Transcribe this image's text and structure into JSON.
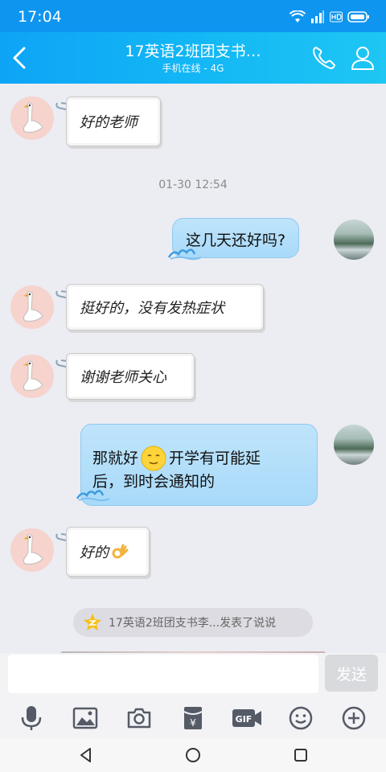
{
  "status_bar": {
    "time": "17:04"
  },
  "header": {
    "title": "17英语2班团支书…",
    "subtitle": "手机在线 - 4G"
  },
  "chat": {
    "timestamp": "01-30 12:54",
    "messages": [
      {
        "sender": "other",
        "text": "好的老师"
      },
      {
        "sender": "me",
        "text": "这几天还好吗?"
      },
      {
        "sender": "other",
        "text": "挺好的，没有发热症状"
      },
      {
        "sender": "other",
        "text": "谢谢老师关心"
      },
      {
        "sender": "me",
        "text_line1_before_emoji": "那就好",
        "text_line1_after_emoji": "开学有可能延",
        "text_line2": "后，到时会通知的",
        "emoji": "smile-emoji"
      },
      {
        "sender": "other",
        "text": "好的",
        "emoji": "ok-hand-emoji"
      }
    ],
    "notice": {
      "text": "17英语2班团支书李...发表了说说"
    }
  },
  "input": {
    "value": "",
    "placeholder": "",
    "send_label": "发送"
  },
  "toolbar": {
    "icons": [
      "microphone-icon",
      "image-icon",
      "camera-icon",
      "red-packet-icon",
      "gif-icon",
      "emoji-icon",
      "plus-icon"
    ],
    "red_packet_symbol": "¥",
    "gif_label": "GIF"
  },
  "colors": {
    "status_bar": "#0e95f0",
    "header_start": "#0ea4f6",
    "header_end": "#1ec6f3",
    "chat_background": "#ececf3",
    "my_bubble": "#a8daf9",
    "send_button": "#d9dade"
  }
}
